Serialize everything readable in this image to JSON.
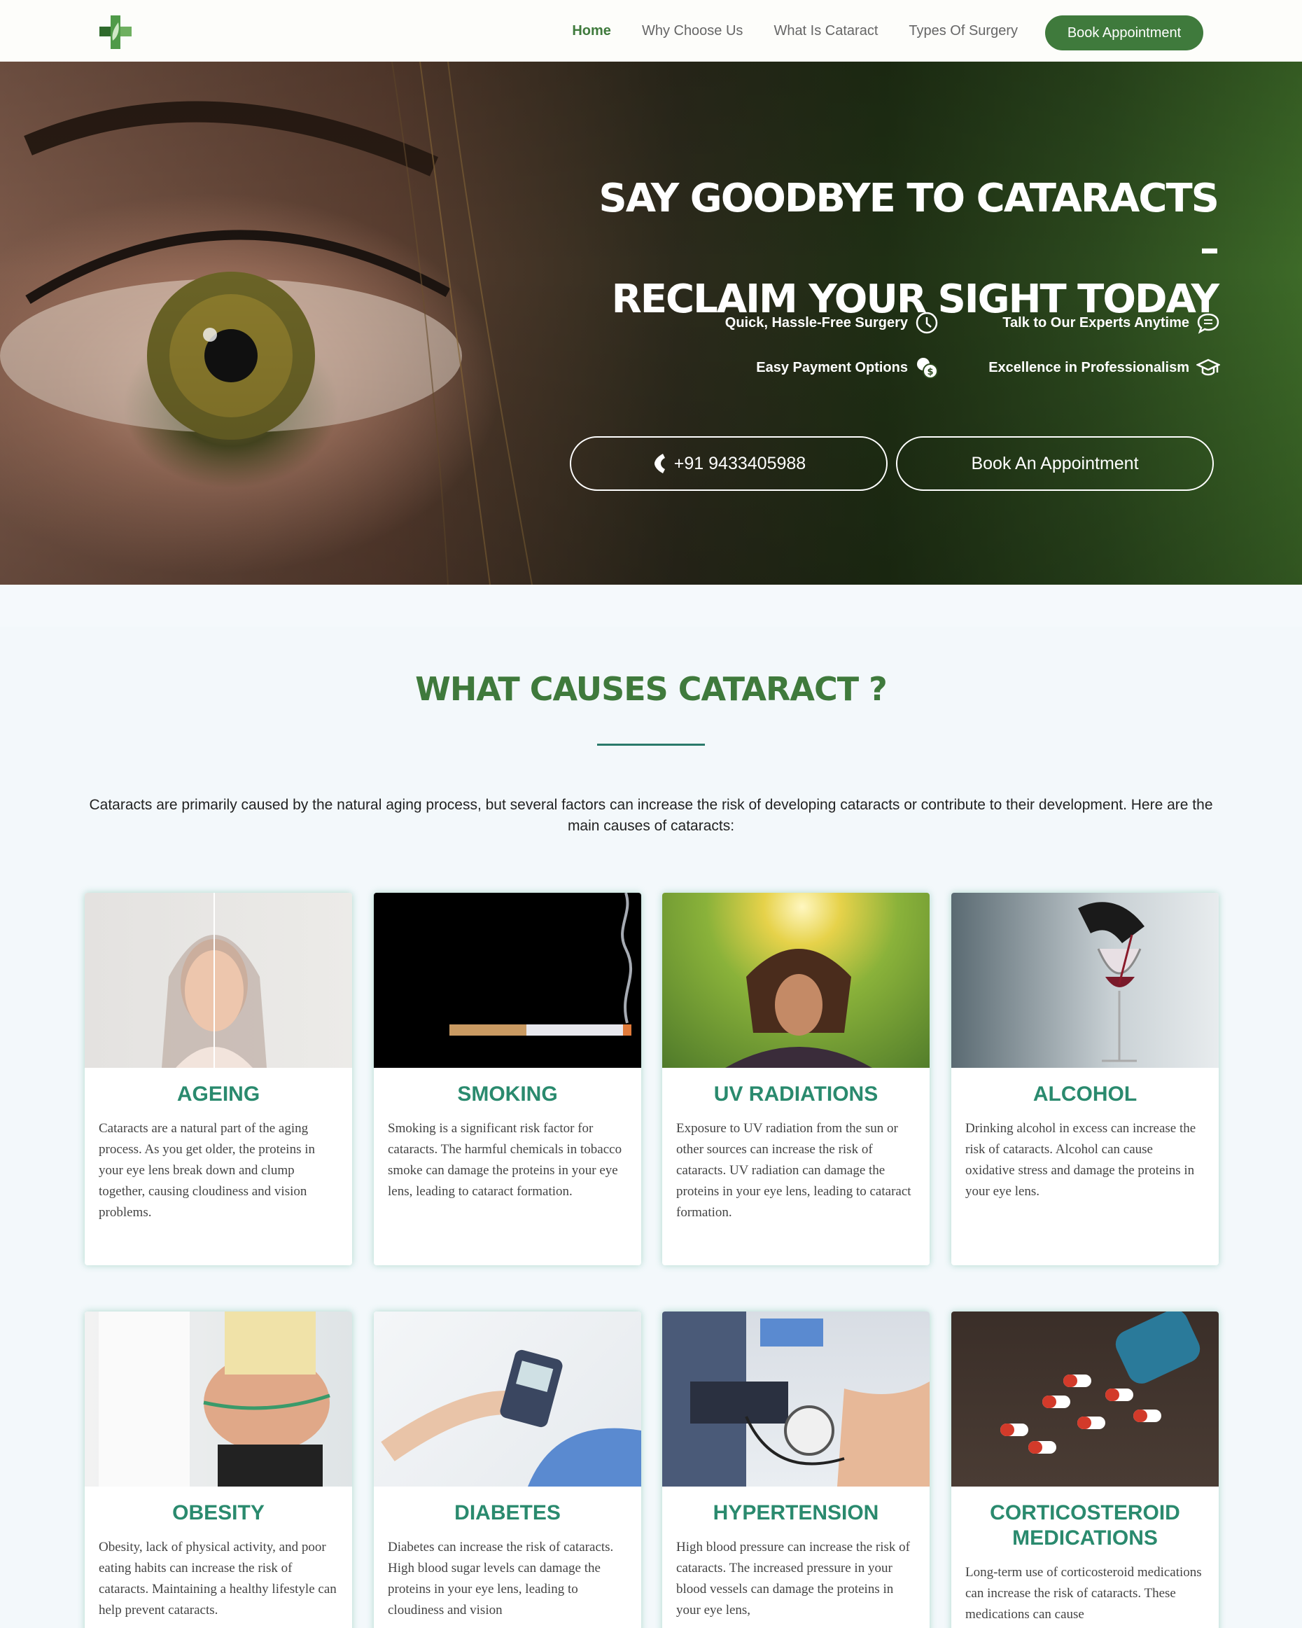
{
  "nav": {
    "links": [
      {
        "label": "Home",
        "active": true
      },
      {
        "label": "Why Choose Us",
        "active": false
      },
      {
        "label": "What Is Cataract",
        "active": false
      },
      {
        "label": "Types Of Surgery",
        "active": false
      }
    ],
    "cta_label": "Book Appointment"
  },
  "hero": {
    "title_line1": "SAY GOODBYE TO CATARACTS –",
    "title_line2": "RECLAIM YOUR SIGHT TODAY",
    "features": [
      {
        "label": "Quick, Hassle-Free Surgery",
        "icon": "clock-icon"
      },
      {
        "label": "Talk to Our Experts Anytime",
        "icon": "chat-icon"
      },
      {
        "label": "Easy Payment Options",
        "icon": "coins-icon"
      },
      {
        "label": "Excellence in Professionalism",
        "icon": "graduation-cap-icon"
      }
    ],
    "phone_label": "+91 9433405988",
    "book_label": "Book An Appointment"
  },
  "causes": {
    "title": "WHAT CAUSES CATARACT ?",
    "intro": "Cataracts are primarily caused by the natural aging process, but several factors can increase the risk of developing cataracts or contribute to their development. Here are the main causes of cataracts:",
    "cards": [
      {
        "title": "AGEING",
        "text": "Cataracts are a natural part of the aging process. As you get older, the proteins in your eye lens break down and clump together, causing cloudiness and vision problems."
      },
      {
        "title": "SMOKING",
        "text": "Smoking is a significant risk factor for cataracts. The harmful chemicals in tobacco smoke can damage the proteins in your eye lens, leading to cataract formation."
      },
      {
        "title": "UV RADIATIONS",
        "text": "Exposure to UV radiation from the sun or other sources can increase the risk of cataracts. UV radiation can damage the proteins in your eye lens, leading to cataract formation."
      },
      {
        "title": "ALCOHOL",
        "text": "Drinking alcohol in excess can increase the risk of cataracts. Alcohol can cause oxidative stress and damage the proteins in your eye lens."
      },
      {
        "title": "OBESITY",
        "text": "Obesity, lack of physical activity, and poor eating habits can increase the risk of cataracts. Maintaining a healthy lifestyle can help prevent cataracts."
      },
      {
        "title": "DIABETES",
        "text": "Diabetes can increase the risk of cataracts. High blood sugar levels can damage the proteins in your eye lens, leading to cloudiness and vision"
      },
      {
        "title": "HYPERTENSION",
        "text": "High blood pressure can increase the risk of cataracts. The increased pressure in your blood vessels can damage the proteins in your eye lens,"
      },
      {
        "title": "CORTICOSTEROID MEDICATIONS",
        "text": "Long-term use of corticosteroid medications can increase the risk of cataracts. These medications can cause"
      }
    ]
  },
  "colors": {
    "brand_green": "#3f7a3c",
    "teal": "#2a8a6e"
  }
}
